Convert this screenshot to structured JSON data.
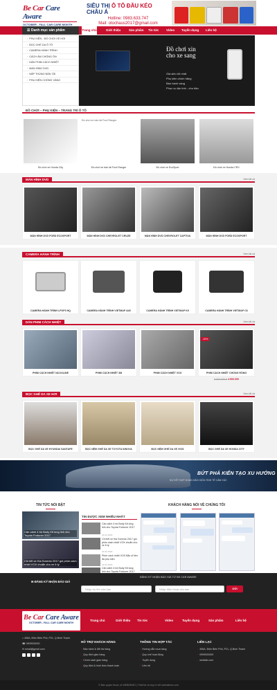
{
  "header": {
    "logo_main_a": "Be Car",
    "logo_main_b": " Care Aware",
    "logo_tag": "OCTOBER - FALL CAR CARE MONTH",
    "hotline_title_a": "SIÊU THỊ ",
    "hotline_title_b": "Ô TÔ ĐẦU KÉO",
    "hotline_title_c": " CHÂU Á",
    "hotline_phone": "Hotline: 0983.633.747",
    "hotline_email": "Mail: otochaus2017@gmail.com"
  },
  "nav": {
    "category_button": "Danh mục sản phẩm",
    "items": [
      "Trang chủ",
      "Giới thiệu",
      "Sản phẩm",
      "Tin tức",
      "Video",
      "Tuyển dụng",
      "Liên hệ"
    ]
  },
  "sidebar": {
    "items": [
      "PHỤ KIỆN - ĐỒ CHƠI XE HƠI",
      "BỌC GHẾ DA Ô TÔ",
      "CAMERA HÀNH TRÌNH",
      "CÁCH ÂM CHỐNG ỒN",
      "DÁN PHIM CÁCH NHIỆT",
      "MÀN HÌNH DVD",
      "NẮP THÙNG BÁN TẢI",
      "PHỤ KIỆN CHỐNG VÀNG"
    ]
  },
  "slider": {
    "line1": "Đồ chơi xin",
    "line2": "cho xe sang",
    "bullets": [
      "Giá siêu tốt nhất",
      "Phụ kiện chính hãng",
      "Bảo hành vàng",
      "Phục vụ tận tình - chu đáo"
    ]
  },
  "sections": {
    "toys": {
      "title": "ĐỒ CHƠI – PHỤ KIỆN – TRANG TRÍ Ô TÔ",
      "items": [
        "Đồ chơi xe Honda City",
        "Đồ chơi xe bán tải Ford Ranger",
        "Đồ chơi xe EcoSport",
        "Đồ chơi xe Honda CRV"
      ],
      "broken_alt": "Đồ chơi xe bán tải Ford Ranger"
    },
    "dvd": {
      "title": "MÀN HÌNH DVD",
      "more": "Xem tất cả",
      "items": [
        "MÀN HÌNH DVD FORD ECOSPORT",
        "MÀN HÌNH DVD CHEVROLET CRUZE",
        "MÀN HÌNH DVD CHEVROLET CAPTIVA",
        "MÀN HÌNH DVD FORD ECOSPORT"
      ]
    },
    "camera": {
      "title": "CAMERA HÀNH TRÌNH",
      "more": "Xem tất cả",
      "items": [
        "CAMERA HÀNH TRÌNH LFOP3 HQ",
        "CAMERA HÀNH TRÌNH VIETMAP A45",
        "CAMERA HÀNH TRÌNH VIETMAP K9",
        "CAMERA HÀNH TRÌNH VIETMAP C6"
      ]
    },
    "film": {
      "title": "DÁN PHIM CÁCH NHIỆT",
      "more": "Xem tất cả",
      "items": [
        "PHIM CÁCH NHIỆT NCOOLINE",
        "PHIM CÁCH NHIỆT 3M",
        "PHIM CÁCH NHIỆT VOX",
        "PHIM CÁCH NHIỆT CHỐNG RỒNG"
      ],
      "sale_badge": "-10%",
      "old_price": "5.000.000 đ",
      "new_price": "4.500.000"
    },
    "seats": {
      "title": "BỌC GHẾ DA XE HƠI",
      "more": "Xem tất cả",
      "items": [
        "BỌC GHẾ DA XE HYUNDAI SANTAFE",
        "BỌC NỆM GHẾ DA XE TOYOTA INNOVA",
        "BỌC NỆM GHẾ DA XE VIOS",
        "BỌC GHẾ DA XE HONDA CITY"
      ]
    }
  },
  "banner": {
    "slogan": "BỨT PHÁ KIẾN TẠO XU HƯỚNG",
    "sub": "SỰ KẾT HỢP HOÀN HẢO GIỮA TINH TẾ CẢM XÚC"
  },
  "news": {
    "featured_title": "TIN TỨC NỔI BẬT",
    "most_read_title": "TIN ĐƯỢC XEM NHIỀU NHẤT",
    "featured": [
      "Cận cảnh 4 bộ Body Kit lung linh cho Toyota Fortuner 2017",
      "Chi tiết xe Kia Sorento 2017 gói phim cách nhiệt VOX chuẩn cho xe 6 tỷ"
    ],
    "most_read": [
      {
        "title": "Cận cảnh 4 bộ Body Kit lung linh cho Toyota Fortuner 2017",
        "date": "31-01-2018"
      },
      {
        "title": "Chi tiết xe Kia Sorento 2017 gói phim cách nhiệt VOX chuẩn cho xe 6 tỷ",
        "date": "31-01-2018"
      },
      {
        "title": "Phim cách nhiệt VOX Bắc sĩ tiền đa phụ kiện",
        "date": "31-01-2018"
      },
      {
        "title": "Cận cảnh 4 bộ Body Kit lung linh cho Toyota Fortuner 2017",
        "date": "31-01-2018"
      }
    ],
    "testimonials_title": "KHÁCH HÀNG NÓI VỀ CHÚNG TÔI"
  },
  "footer": {
    "newsletter_label": "ĐĂNG KÝ NHẬN BÁO GIÁ",
    "newsletter_note": "ĐĂNG KÝ NHẬN BÁO GIÁ TỪ BE CAR AWARE",
    "name_placeholder": "Nhập họ tên của bạn",
    "phone_placeholder": "Nhập điện thoại của bạn",
    "send": "GỬI",
    "address": "496A, Điện Biên Phủ, P21, Q.Bình Thạnh",
    "phone": "0909000000",
    "email": "email@gmail.com",
    "support_title": "HỖ TRỢ KHÁCH HÀNG",
    "support_items": [
      "Bảo hành & đổi trả hàng",
      "Quy định giao hàng",
      "Chính sách giao hàng",
      "Quy định & hình thức thanh toán"
    ],
    "partner_title": "THÔNG TIN HỢP TÁC",
    "partner_items": [
      "Hướng dẫn mua hàng",
      "Quy chế hoạt động",
      "Tuyển dụng",
      "Liên hệ"
    ],
    "contact_title": "LIÊN LẠC",
    "contact_items": [
      "496A, Điện Biên Phủ, P21, Q.Bình Thạnh",
      "0999000000",
      "website.com"
    ],
    "copyright": "© Bản quyền thuộc về WEBDEMO | Thiết kế và duy trì bởi websitemo.com",
    "colors": {
      "brand_red": "#c8102e",
      "dark": "#222222",
      "navy": "#1a3a7a"
    }
  }
}
